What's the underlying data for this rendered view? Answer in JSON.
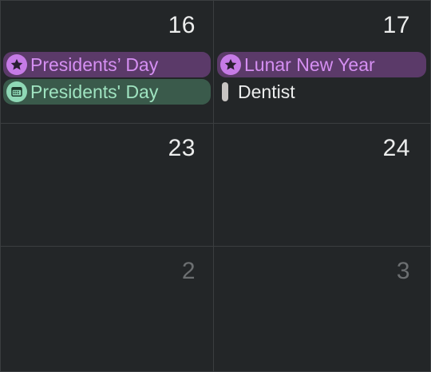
{
  "calendar": {
    "weeks": [
      {
        "days": [
          {
            "number": "16",
            "muted": false,
            "events": [
              {
                "title": "Presidents’ Day",
                "style": "purple",
                "icon": "star-icon"
              },
              {
                "title": "Presidents' Day",
                "style": "green",
                "icon": "calendar-icon"
              }
            ]
          },
          {
            "number": "17",
            "muted": false,
            "events": [
              {
                "title": "Lunar New Year",
                "style": "purple",
                "icon": "star-icon"
              },
              {
                "title": "Dentist",
                "style": "plain",
                "icon": "event-bar"
              }
            ]
          }
        ]
      },
      {
        "days": [
          {
            "number": "23",
            "muted": false,
            "events": []
          },
          {
            "number": "24",
            "muted": false,
            "events": []
          }
        ]
      },
      {
        "days": [
          {
            "number": "2",
            "muted": true,
            "events": []
          },
          {
            "number": "3",
            "muted": true,
            "events": []
          }
        ]
      }
    ]
  },
  "colors": {
    "background": "#232628",
    "gridline": "#3b3e40",
    "holiday_purple_bg": "#5b3a69",
    "holiday_purple_text": "#d58ff2",
    "calendar_green_bg": "#3a5a4b",
    "calendar_green_text": "#9fe3c0",
    "day_number": "#eceded",
    "day_number_muted": "#6c6f71"
  }
}
